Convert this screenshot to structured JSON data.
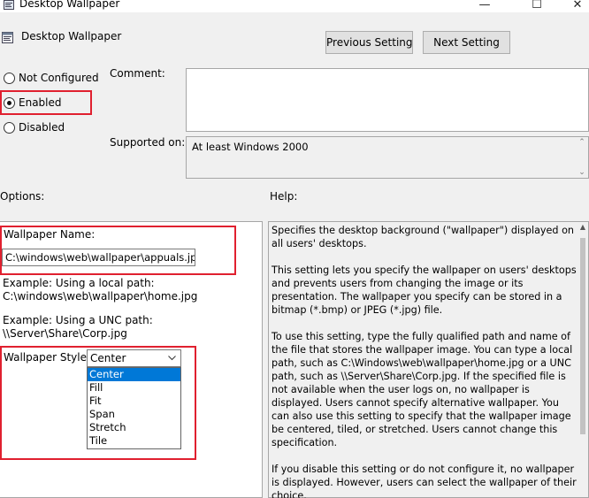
{
  "window": {
    "title": "Desktop Wallpaper",
    "minimize": "—",
    "maximize": "☐",
    "close": "✕"
  },
  "header": {
    "title": "Desktop Wallpaper",
    "prev_button": "Previous Setting",
    "next_button": "Next Setting"
  },
  "state": {
    "not_configured": "Not Configured",
    "enabled": "Enabled",
    "disabled": "Disabled",
    "selected": "Enabled"
  },
  "comment": {
    "label": "Comment:",
    "value": ""
  },
  "supported": {
    "label": "Supported on:",
    "value": "At least Windows 2000"
  },
  "options": {
    "label": "Options:",
    "wallpaper_name_label": "Wallpaper Name:",
    "wallpaper_name_value": "C:\\windows\\web\\wallpaper\\appuals.jpg",
    "example_local_1": "Example: Using a local path:",
    "example_local_2": "C:\\windows\\web\\wallpaper\\home.jpg",
    "example_unc_1": "Example: Using a UNC path:",
    "example_unc_2": "\\\\Server\\Share\\Corp.jpg",
    "style_label": "Wallpaper Style:",
    "style_value": "Center",
    "style_options": [
      "Center",
      "Fill",
      "Fit",
      "Span",
      "Stretch",
      "Tile"
    ]
  },
  "help": {
    "label": "Help:",
    "paragraphs": [
      "Specifies the desktop background (\"wallpaper\") displayed on all users' desktops.",
      "This setting lets you specify the wallpaper on users' desktops and prevents users from changing the image or its presentation. The wallpaper you specify can be stored in a bitmap (*.bmp) or JPEG (*.jpg) file.",
      "To use this setting, type the fully qualified path and name of the file that stores the wallpaper image. You can type a local path, such as C:\\Windows\\web\\wallpaper\\home.jpg or a UNC path, such as \\\\Server\\Share\\Corp.jpg. If the specified file is not available when the user logs on, no wallpaper is displayed. Users cannot specify alternative wallpaper. You can also use this setting to specify that the wallpaper image be centered, tiled, or stretched. Users cannot change this specification.",
      "If you disable this setting or do not configure it, no wallpaper is displayed. However, users can select the wallpaper of their choice."
    ]
  }
}
